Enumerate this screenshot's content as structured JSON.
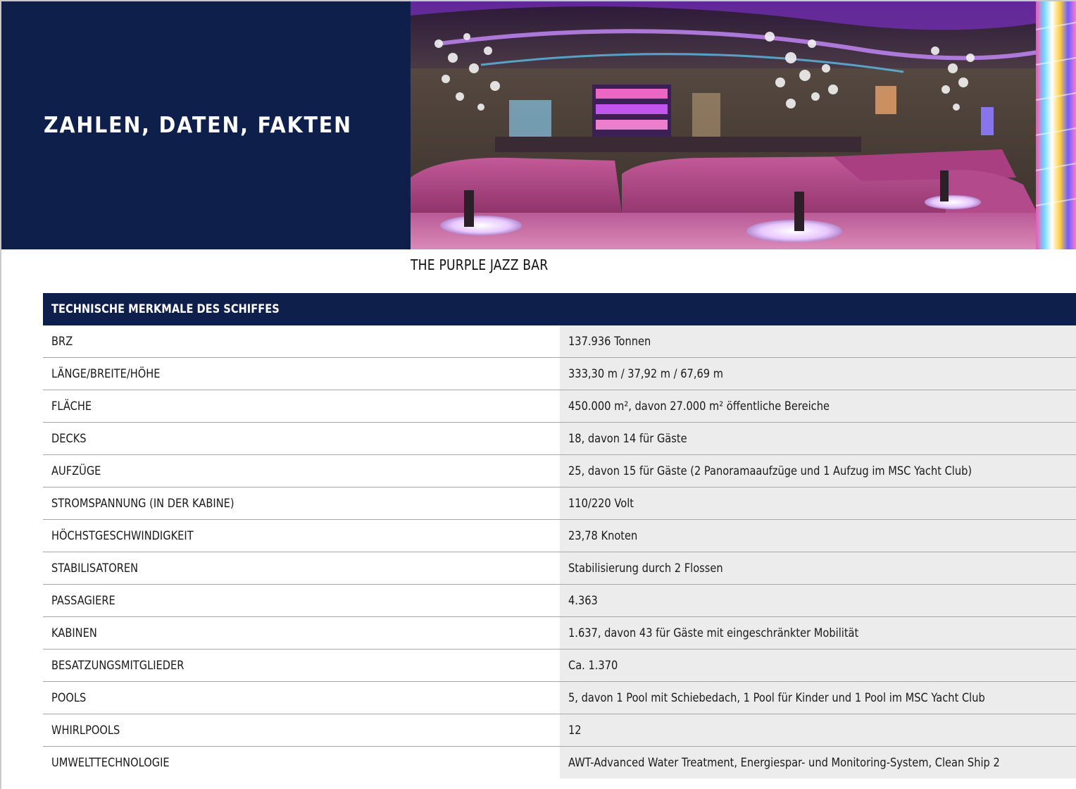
{
  "hero": {
    "title": "ZAHLEN, DATEN, FAKTEN"
  },
  "caption": "THE PURPLE JAZZ BAR",
  "colors": {
    "navy": "#0d1f4a",
    "value_bg": "#ececec",
    "row_divider": "#a7a7a7"
  },
  "table": {
    "header": "TECHNISCHE MERKMALE DES SCHIFFES",
    "rows": [
      {
        "label": "BRZ",
        "value": "137.936 Tonnen"
      },
      {
        "label": "LÄNGE/BREITE/HÖHE",
        "value": "333,30 m / 37,92 m / 67,69 m"
      },
      {
        "label": "FLÄCHE",
        "value": "450.000 m², davon 27.000 m² öffentliche Bereiche"
      },
      {
        "label": "DECKS",
        "value": "18, davon 14 für Gäste"
      },
      {
        "label": "AUFZÜGE",
        "value": "25, davon 15 für Gäste (2 Panoramaaufzüge und 1 Aufzug im MSC Yacht Club)"
      },
      {
        "label": "STROMSPANNUNG (IN DER KABINE)",
        "value": "110/220 Volt"
      },
      {
        "label": "HÖCHSTGESCHWINDIGKEIT",
        "value": "23,78 Knoten"
      },
      {
        "label": "STABILISATOREN",
        "value": "Stabilisierung durch 2 Flossen"
      },
      {
        "label": "PASSAGIERE",
        "value": "4.363"
      },
      {
        "label": "KABINEN",
        "value": "1.637, davon 43 für Gäste mit eingeschränkter Mobilität"
      },
      {
        "label": "BESATZUNGSMITGLIEDER",
        "value": "Ca. 1.370"
      },
      {
        "label": "POOLS",
        "value": "5, davon 1 Pool mit Schiebedach, 1 Pool für Kinder und 1 Pool im MSC Yacht Club"
      },
      {
        "label": "WHIRLPOOLS",
        "value": "12"
      },
      {
        "label": "UMWELTTECHNOLOGIE",
        "value": "AWT-Advanced Water Treatment, Energiespar- und Monitoring-System, Clean Ship 2"
      }
    ]
  }
}
